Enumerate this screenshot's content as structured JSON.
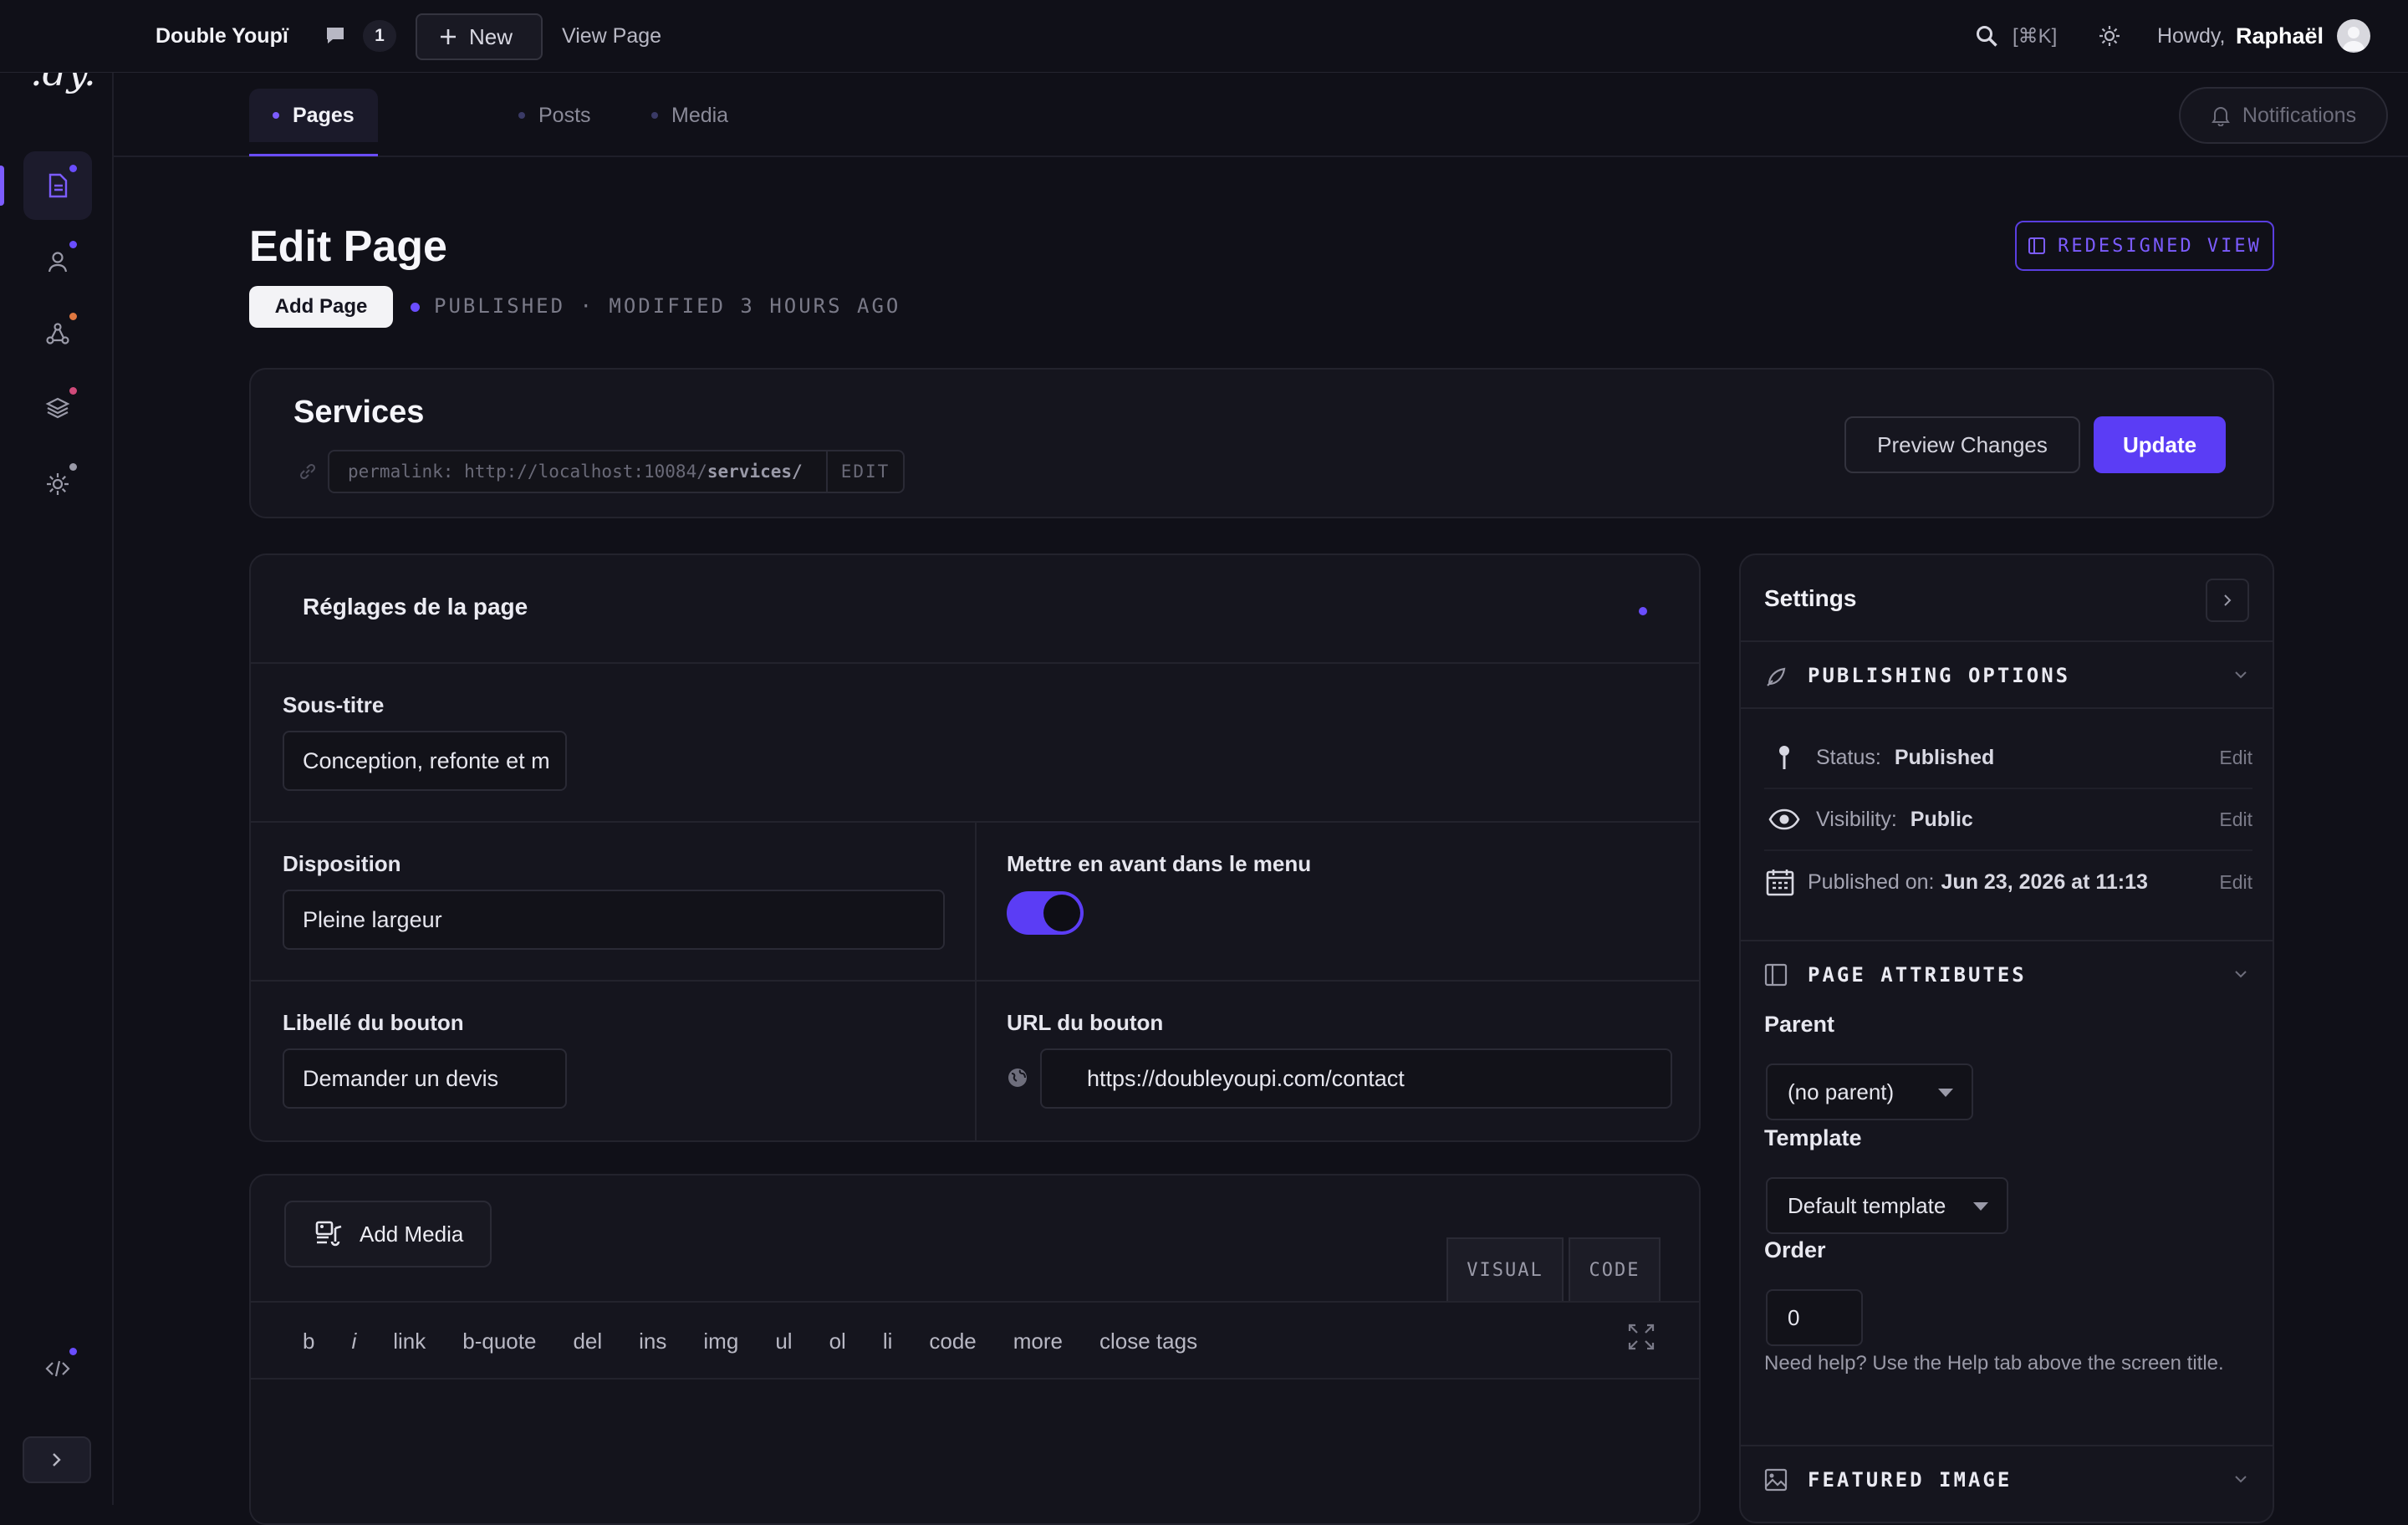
{
  "admin_bar": {
    "site_name": "Double Youpï",
    "comment_count": "1",
    "new_label": "New",
    "view_page": "View Page",
    "search_shortcut": "[⌘K]",
    "howdy": "Howdy,",
    "user_name": "Raphaël"
  },
  "sidebar": {
    "logo_text": ".dy.",
    "items": [
      {
        "name": "pages",
        "icon": "document-icon",
        "dot_color": "#6a4dff",
        "active": true
      },
      {
        "name": "users",
        "icon": "user-icon",
        "dot_color": "#6a4dff"
      },
      {
        "name": "plugins",
        "icon": "network-icon",
        "dot_color": "#e07840"
      },
      {
        "name": "layers",
        "icon": "layers-icon",
        "dot_color": "#d04a7a"
      },
      {
        "name": "settings",
        "icon": "sun-gear-icon",
        "dot_color": "#9a9aa8"
      },
      {
        "name": "code",
        "icon": "code-icon",
        "dot_color": "#6a4dff"
      }
    ]
  },
  "subnav": {
    "tabs": [
      {
        "label": "Pages",
        "active": true
      },
      {
        "label": "Posts"
      },
      {
        "label": "Media"
      }
    ],
    "notifications": "Notifications"
  },
  "page_header": {
    "title": "Edit Page",
    "add_page": "Add Page",
    "status_line": "PUBLISHED · MODIFIED 3 HOURS AGO",
    "redesigned_view": "REDESIGNED VIEW"
  },
  "title_card": {
    "post_title": "Services",
    "permalink_prefix": "permalink: http://localhost:10084/",
    "permalink_slug": "services/",
    "permalink_edit": "EDIT",
    "preview_changes": "Preview Changes",
    "update": "Update"
  },
  "fields": {
    "section_title": "Réglages de la page",
    "subtitle_label": "Sous-titre",
    "subtitle_value": "Conception, refonte et m",
    "layout_label": "Disposition",
    "layout_value": "Pleine largeur",
    "featured_label": "Mettre en avant dans le menu",
    "featured_on": true,
    "button_label_label": "Libellé du bouton",
    "button_label_value": "Demander un devis",
    "button_url_label": "URL du bouton",
    "button_url_value": "https://doubleyoupi.com/contact"
  },
  "editor": {
    "add_media": "Add Media",
    "tab_visual": "VISUAL",
    "tab_code": "CODE",
    "quicktags": [
      "b",
      "i",
      "link",
      "b-quote",
      "del",
      "ins",
      "img",
      "ul",
      "ol",
      "li",
      "code",
      "more",
      "close tags"
    ]
  },
  "settings": {
    "title": "Settings",
    "publishing_title": "PUBLISHING OPTIONS",
    "status_label": "Status:",
    "status_value": "Published",
    "visibility_label": "Visibility:",
    "visibility_value": "Public",
    "published_label": "Published on:",
    "published_value": "Jun 23, 2026 at 11:13",
    "edit": "Edit",
    "attributes_title": "PAGE ATTRIBUTES",
    "parent_label": "Parent",
    "parent_value": "(no parent)",
    "template_label": "Template",
    "template_value": "Default template",
    "order_label": "Order",
    "order_value": "0",
    "help_text": "Need help? Use the Help tab above the screen title.",
    "featured_image_title": "FEATURED IMAGE"
  },
  "colors": {
    "accent": "#5b3df5",
    "background": "#101018",
    "card": "#15151e"
  }
}
